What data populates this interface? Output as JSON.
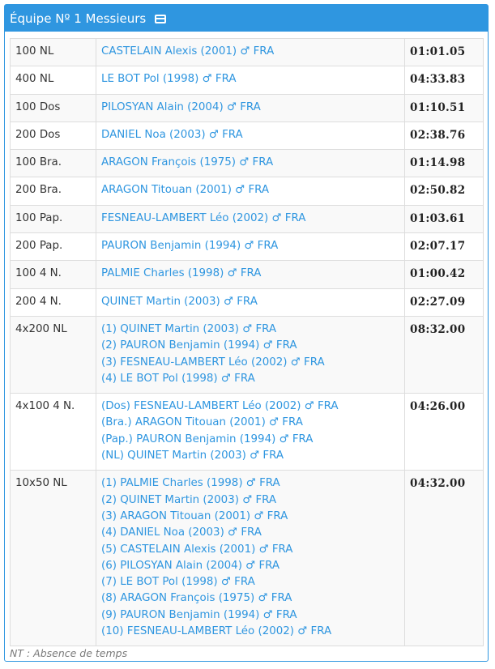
{
  "header": {
    "title": "Équipe Nº 1 Messieurs",
    "icon": "id-card-icon"
  },
  "rows": [
    {
      "event": "100 NL",
      "swimmers": [
        "CASTELAIN Alexis (2001) ♂ FRA"
      ],
      "time": "01:01.05"
    },
    {
      "event": "400 NL",
      "swimmers": [
        "LE BOT Pol (1998) ♂ FRA"
      ],
      "time": "04:33.83"
    },
    {
      "event": "100 Dos",
      "swimmers": [
        "PILOSYAN Alain (2004) ♂ FRA"
      ],
      "time": "01:10.51"
    },
    {
      "event": "200 Dos",
      "swimmers": [
        "DANIEL Noa (2003) ♂ FRA"
      ],
      "time": "02:38.76"
    },
    {
      "event": "100 Bra.",
      "swimmers": [
        "ARAGON François (1975) ♂ FRA"
      ],
      "time": "01:14.98"
    },
    {
      "event": "200 Bra.",
      "swimmers": [
        "ARAGON Titouan (2001) ♂ FRA"
      ],
      "time": "02:50.82"
    },
    {
      "event": "100 Pap.",
      "swimmers": [
        "FESNEAU-LAMBERT Léo (2002) ♂ FRA"
      ],
      "time": "01:03.61"
    },
    {
      "event": "200 Pap.",
      "swimmers": [
        "PAURON Benjamin (1994) ♂ FRA"
      ],
      "time": "02:07.17"
    },
    {
      "event": "100 4 N.",
      "swimmers": [
        "PALMIE Charles (1998) ♂ FRA"
      ],
      "time": "01:00.42"
    },
    {
      "event": "200 4 N.",
      "swimmers": [
        "QUINET Martin (2003) ♂ FRA"
      ],
      "time": "02:27.09"
    },
    {
      "event": "4x200 NL",
      "swimmers": [
        "(1) QUINET Martin (2003) ♂ FRA",
        "(2) PAURON Benjamin (1994) ♂ FRA",
        "(3) FESNEAU-LAMBERT Léo (2002) ♂ FRA",
        "(4) LE BOT Pol (1998) ♂ FRA"
      ],
      "time": "08:32.00"
    },
    {
      "event": "4x100 4 N.",
      "swimmers": [
        "(Dos) FESNEAU-LAMBERT Léo (2002) ♂ FRA",
        "(Bra.) ARAGON Titouan (2001) ♂ FRA",
        "(Pap.) PAURON Benjamin (1994) ♂ FRA",
        "(NL) QUINET Martin (2003) ♂ FRA"
      ],
      "time": "04:26.00"
    },
    {
      "event": "10x50 NL",
      "swimmers": [
        "(1) PALMIE Charles (1998) ♂ FRA",
        "(2) QUINET Martin (2003) ♂ FRA",
        "(3) ARAGON Titouan (2001) ♂ FRA",
        "(4) DANIEL Noa (2003) ♂ FRA",
        "(5) CASTELAIN Alexis (2001) ♂ FRA",
        "(6) PILOSYAN Alain (2004) ♂ FRA",
        "(7) LE BOT Pol (1998) ♂ FRA",
        "(8) ARAGON François (1975) ♂ FRA",
        "(9) PAURON Benjamin (1994) ♂ FRA",
        "(10) FESNEAU-LAMBERT Léo (2002) ♂ FRA"
      ],
      "time": "04:32.00"
    }
  ],
  "footnote": "NT : Absence de temps",
  "colors": {
    "accent": "#2f96e0",
    "link": "#2f96e0",
    "stripe": "#f9f9f9",
    "border": "#dddddd"
  }
}
